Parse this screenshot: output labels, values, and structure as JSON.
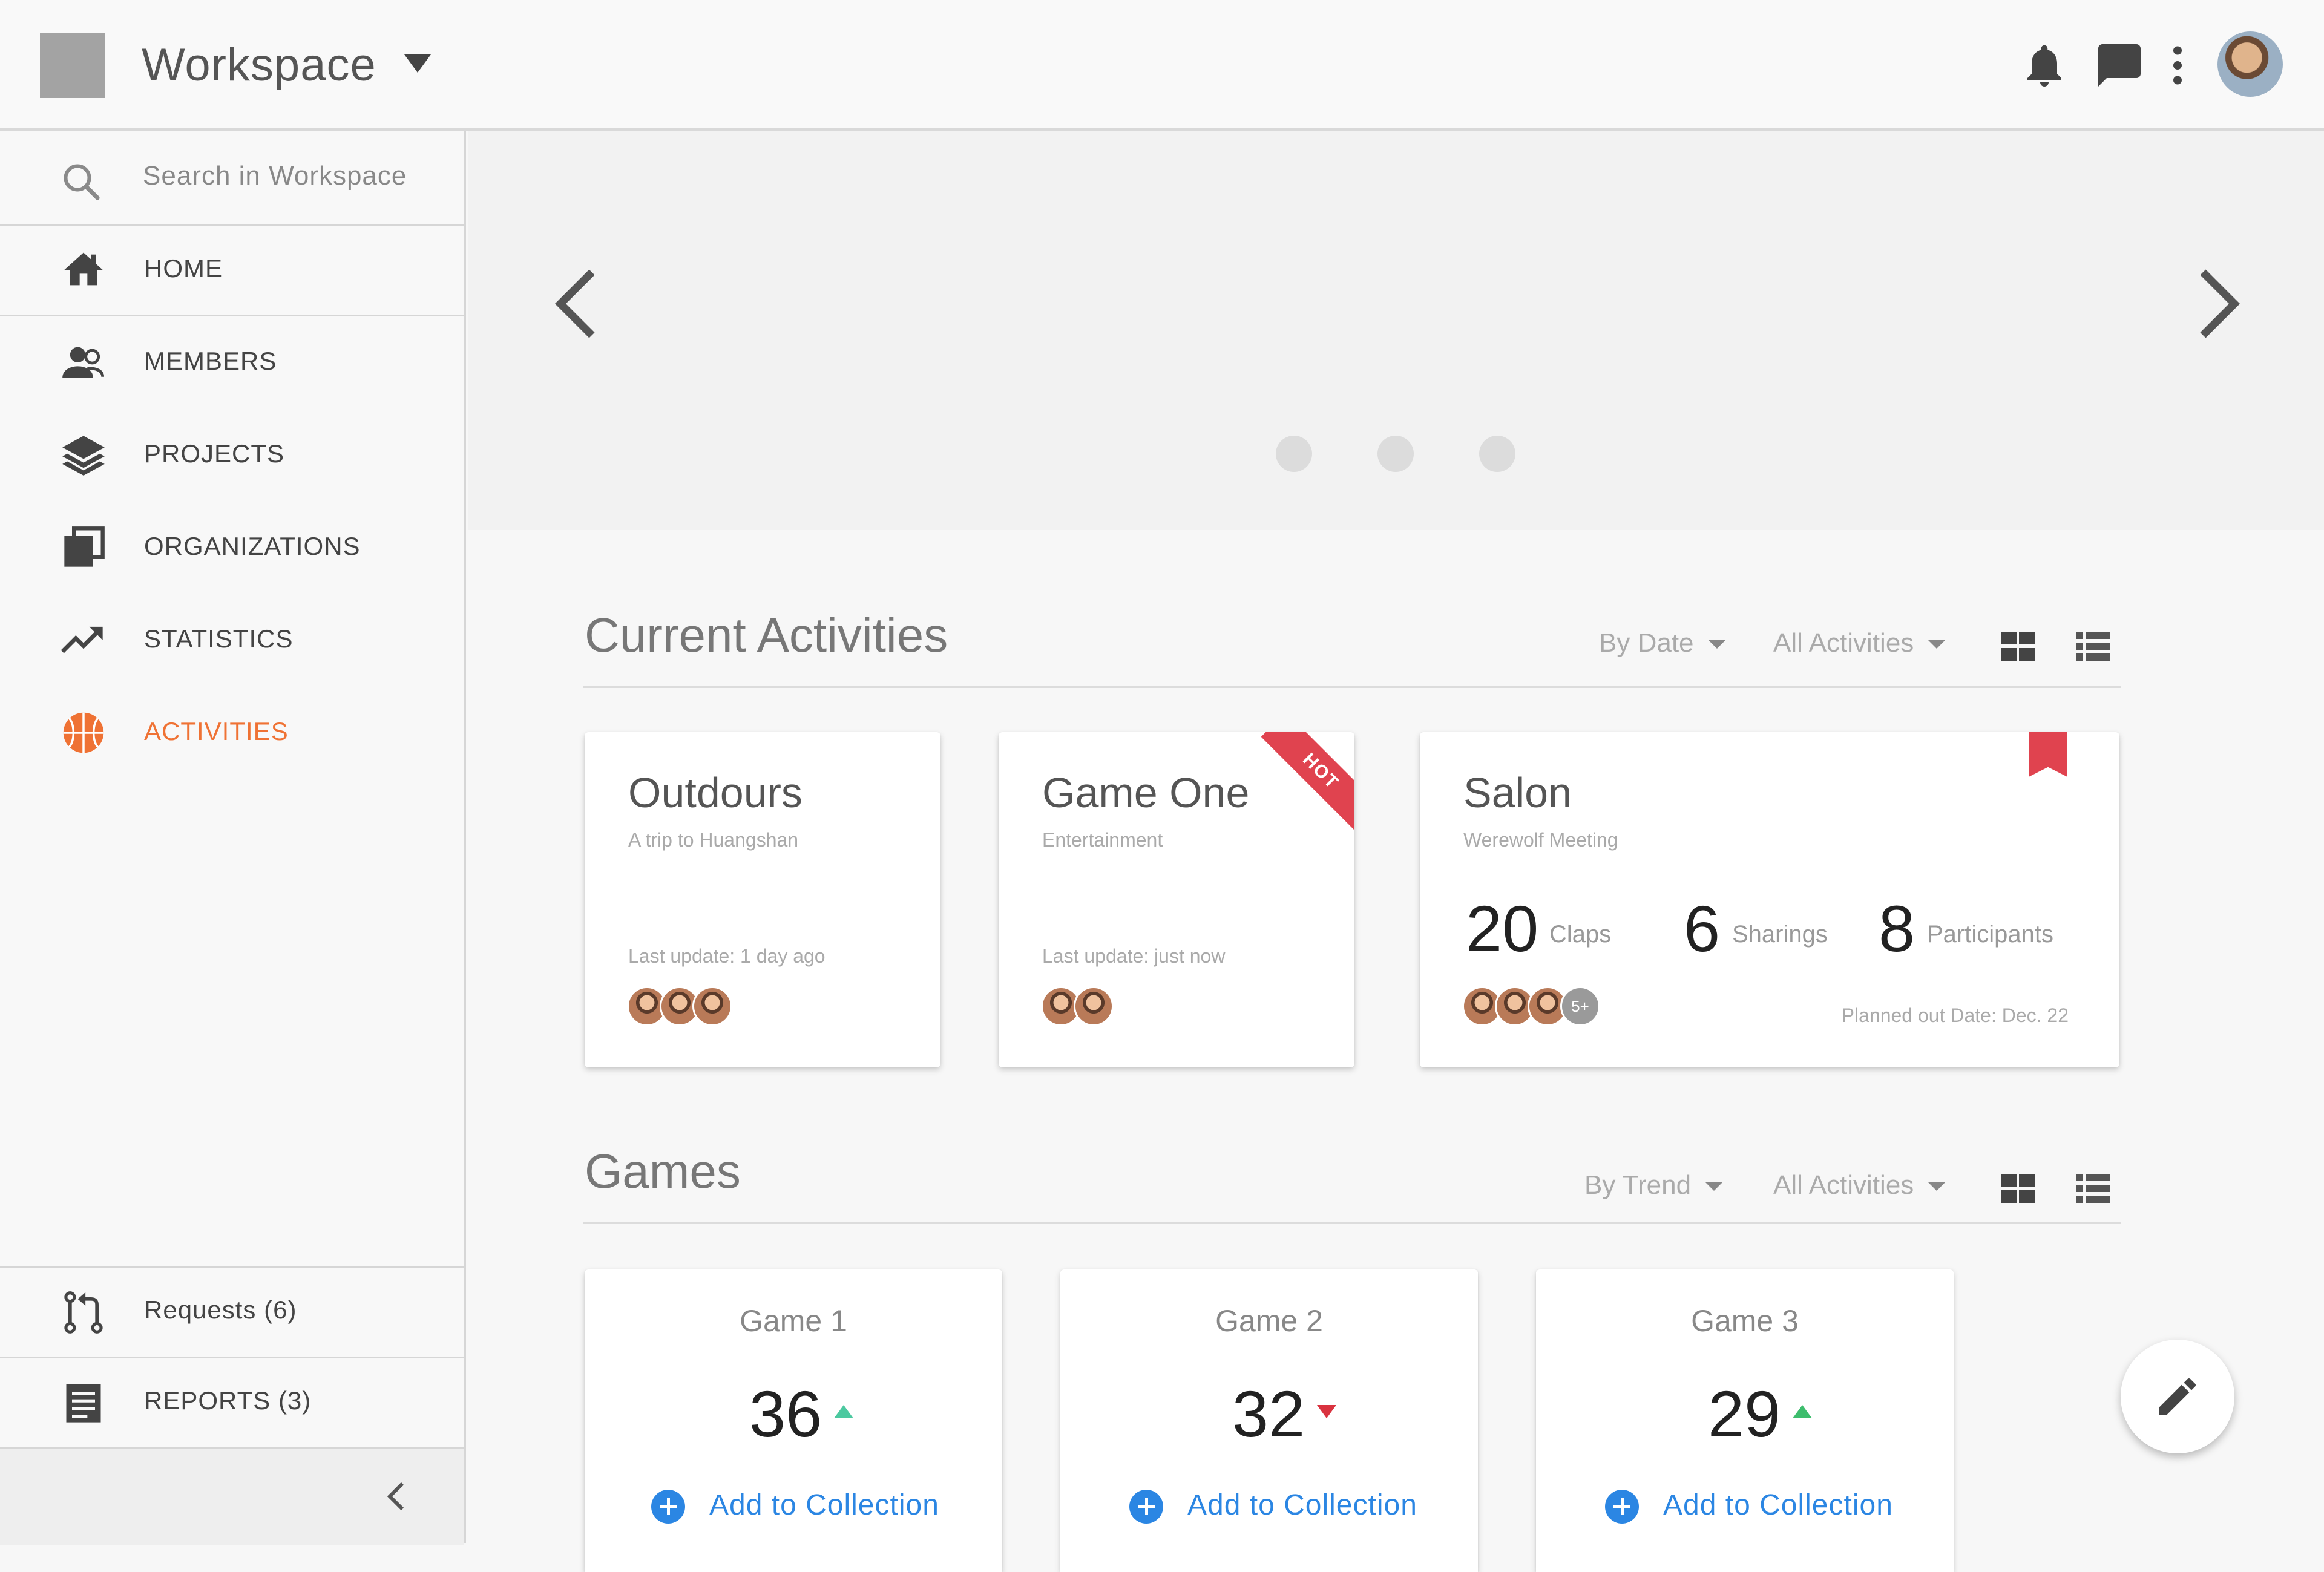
{
  "header": {
    "workspace_title": "Workspace",
    "icons": [
      "bell-icon",
      "chat-icon",
      "more-vert-icon"
    ],
    "avatar": "user-avatar"
  },
  "sidebar": {
    "search_placeholder": "Search in Workspace",
    "items": [
      {
        "label": "HOME",
        "icon": "home-icon"
      },
      {
        "label": "MEMBERS",
        "icon": "members-icon"
      },
      {
        "label": "PROJECTS",
        "icon": "layers-icon"
      },
      {
        "label": "ORGANIZATIONS",
        "icon": "organizations-icon"
      },
      {
        "label": "STATISTICS",
        "icon": "trending-icon"
      },
      {
        "label": "ACTIVITIES",
        "icon": "basketball-icon",
        "active": true
      }
    ],
    "bottom_items": [
      {
        "label": "Requests (6)",
        "icon": "pull-request-icon"
      },
      {
        "label": "REPORTS (3)",
        "icon": "report-icon"
      }
    ],
    "collapse_icon": "chevron-left-icon"
  },
  "carousel": {
    "slides": 3
  },
  "current_activities": {
    "title": "Current Activities",
    "sort": "By Date",
    "filter": "All Activities",
    "cards": [
      {
        "title": "Outdours",
        "subtitle": "A trip to Huangshan",
        "updated": "Last update: 1 day ago",
        "avatars": 3
      },
      {
        "title": "Game One",
        "subtitle": "Entertainment",
        "updated": "Last update: just now",
        "avatars": 2,
        "ribbon": "HOT"
      },
      {
        "title": "Salon",
        "subtitle": "Werewolf Meeting",
        "stats": [
          {
            "value": "20",
            "label": "Claps"
          },
          {
            "value": "6",
            "label": "Sharings"
          },
          {
            "value": "8",
            "label": "Participants"
          }
        ],
        "avatars": 3,
        "more": "5+",
        "planned": "Planned out Date: Dec. 22",
        "bookmarked": true
      }
    ]
  },
  "games": {
    "title": "Games",
    "sort": "By Trend",
    "filter": "All Activities",
    "cards": [
      {
        "title": "Game 1",
        "value": "36",
        "trend": "up",
        "action": "Add to Collection"
      },
      {
        "title": "Game 2",
        "value": "32",
        "trend": "down",
        "action": "Add to Collection"
      },
      {
        "title": "Game 3",
        "value": "29",
        "trend": "up",
        "action": "Add to Collection"
      }
    ]
  },
  "colors": {
    "accent": "#ef7234",
    "link": "#2b86e3",
    "hot": "#e0434f",
    "trend_up": "#3dbd6d",
    "trend_down": "#d9323f"
  }
}
